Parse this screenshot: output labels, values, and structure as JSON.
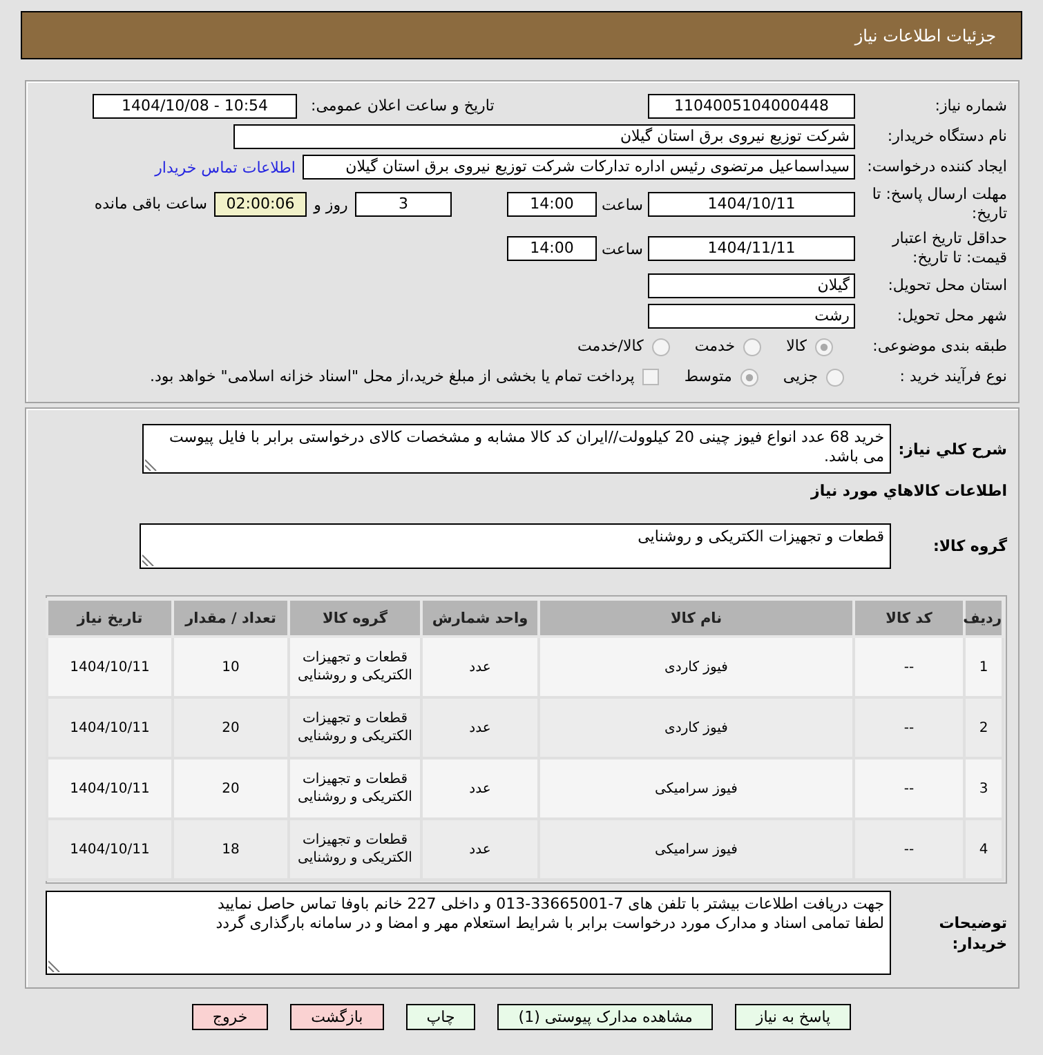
{
  "header": {
    "title": "جزئیات اطلاعات نیاز"
  },
  "details": {
    "need_number": {
      "label": "شماره نیاز:",
      "value": "1104005104000448"
    },
    "announce": {
      "label": "تاریخ و ساعت اعلان عمومی:",
      "value": "1404/10/08 - 10:54"
    },
    "buyer_org": {
      "label": "نام دستگاه خریدار:",
      "value": "شرکت توزیع نیروی برق استان گیلان"
    },
    "requester": {
      "label": "ایجاد کننده درخواست:",
      "value": "سیداسماعیل مرتضوی رئیس اداره تدارکات شرکت توزیع نیروی برق استان گیلان",
      "link": "اطلاعات تماس خریدار"
    },
    "reply_deadline": {
      "label": "مهلت ارسال پاسخ: تا تاریخ:",
      "date": "1404/10/11",
      "time_label": "ساعت",
      "time": "14:00",
      "days": "3",
      "days_label": "روز و",
      "remaining": "02:00:06",
      "remaining_label": "ساعت باقی مانده"
    },
    "price_validity": {
      "label": "حداقل تاریخ اعتبار قیمت: تا تاریخ:",
      "date": "1404/11/11",
      "time_label": "ساعت",
      "time": "14:00"
    },
    "province": {
      "label": "استان محل تحویل:",
      "value": "گیلان"
    },
    "city": {
      "label": "شهر محل تحویل:",
      "value": "رشت"
    },
    "category": {
      "label": "طبقه بندی موضوعی:",
      "options": [
        {
          "label": "کالا",
          "selected": true
        },
        {
          "label": "خدمت",
          "selected": false
        },
        {
          "label": "کالا/خدمت",
          "selected": false
        }
      ]
    },
    "process": {
      "label": "نوع فرآیند خرید :",
      "options": [
        {
          "label": "جزیی",
          "selected": false
        },
        {
          "label": "متوسط",
          "selected": true
        }
      ],
      "treasury": {
        "label": "پرداخت تمام یا بخشی از مبلغ خرید،از محل \"اسناد خزانه اسلامی\" خواهد بود.",
        "checked": false
      }
    }
  },
  "needs": {
    "description": {
      "label": "شرح کلي نیاز:",
      "value": "خرید 68 عدد انواع فیوز چینی 20 کیلوولت//ایران کد کالا مشابه و مشخصات کالای درخواستی برابر با فایل پیوست می باشد."
    },
    "items_title": "اطلاعات کالاهاي مورد نياز",
    "goods_group": {
      "label": "گروه کالا:",
      "value": "قطعات و تجهیزات الکتریکی و روشنایی"
    },
    "table": {
      "columns": [
        "ردیف",
        "کد کالا",
        "نام کالا",
        "واحد شمارش",
        "گروه کالا",
        "تعداد / مقدار",
        "تاریخ نیاز"
      ],
      "rows": [
        [
          "1",
          "--",
          "فیوز کاردی",
          "عدد",
          "قطعات و تجهیزات الکتریکی و روشنایی",
          "10",
          "1404/10/11"
        ],
        [
          "2",
          "--",
          "فیوز کاردی",
          "عدد",
          "قطعات و تجهیزات الکتریکی و روشنایی",
          "20",
          "1404/10/11"
        ],
        [
          "3",
          "--",
          "فیوز سرامیکی",
          "عدد",
          "قطعات و تجهیزات الکتریکی و روشنایی",
          "20",
          "1404/10/11"
        ],
        [
          "4",
          "--",
          "فیوز سرامیکی",
          "عدد",
          "قطعات و تجهیزات الکتریکی و روشنایی",
          "18",
          "1404/10/11"
        ]
      ]
    },
    "buyer_notes": {
      "label": "توضیحات خریدار:",
      "lines": [
        "جهت دریافت اطلاعات بیشتر با تلفن های 7-33665001-013 و داخلی 227 خانم باوفا تماس حاصل نمایید",
        "لطفا تمامی اسناد و مدارک مورد درخواست برابر با شرایط استعلام مهر و امضا و در سامانه بارگذاری گردد"
      ]
    }
  },
  "buttons": [
    {
      "label": "پاسخ به نیاز",
      "kind": "action"
    },
    {
      "label": "مشاهده مدارک پیوستی (1)",
      "kind": "action"
    },
    {
      "label": "چاپ",
      "kind": "action"
    },
    {
      "label": "بازگشت",
      "kind": "exit"
    },
    {
      "label": "خروج",
      "kind": "exit"
    }
  ]
}
